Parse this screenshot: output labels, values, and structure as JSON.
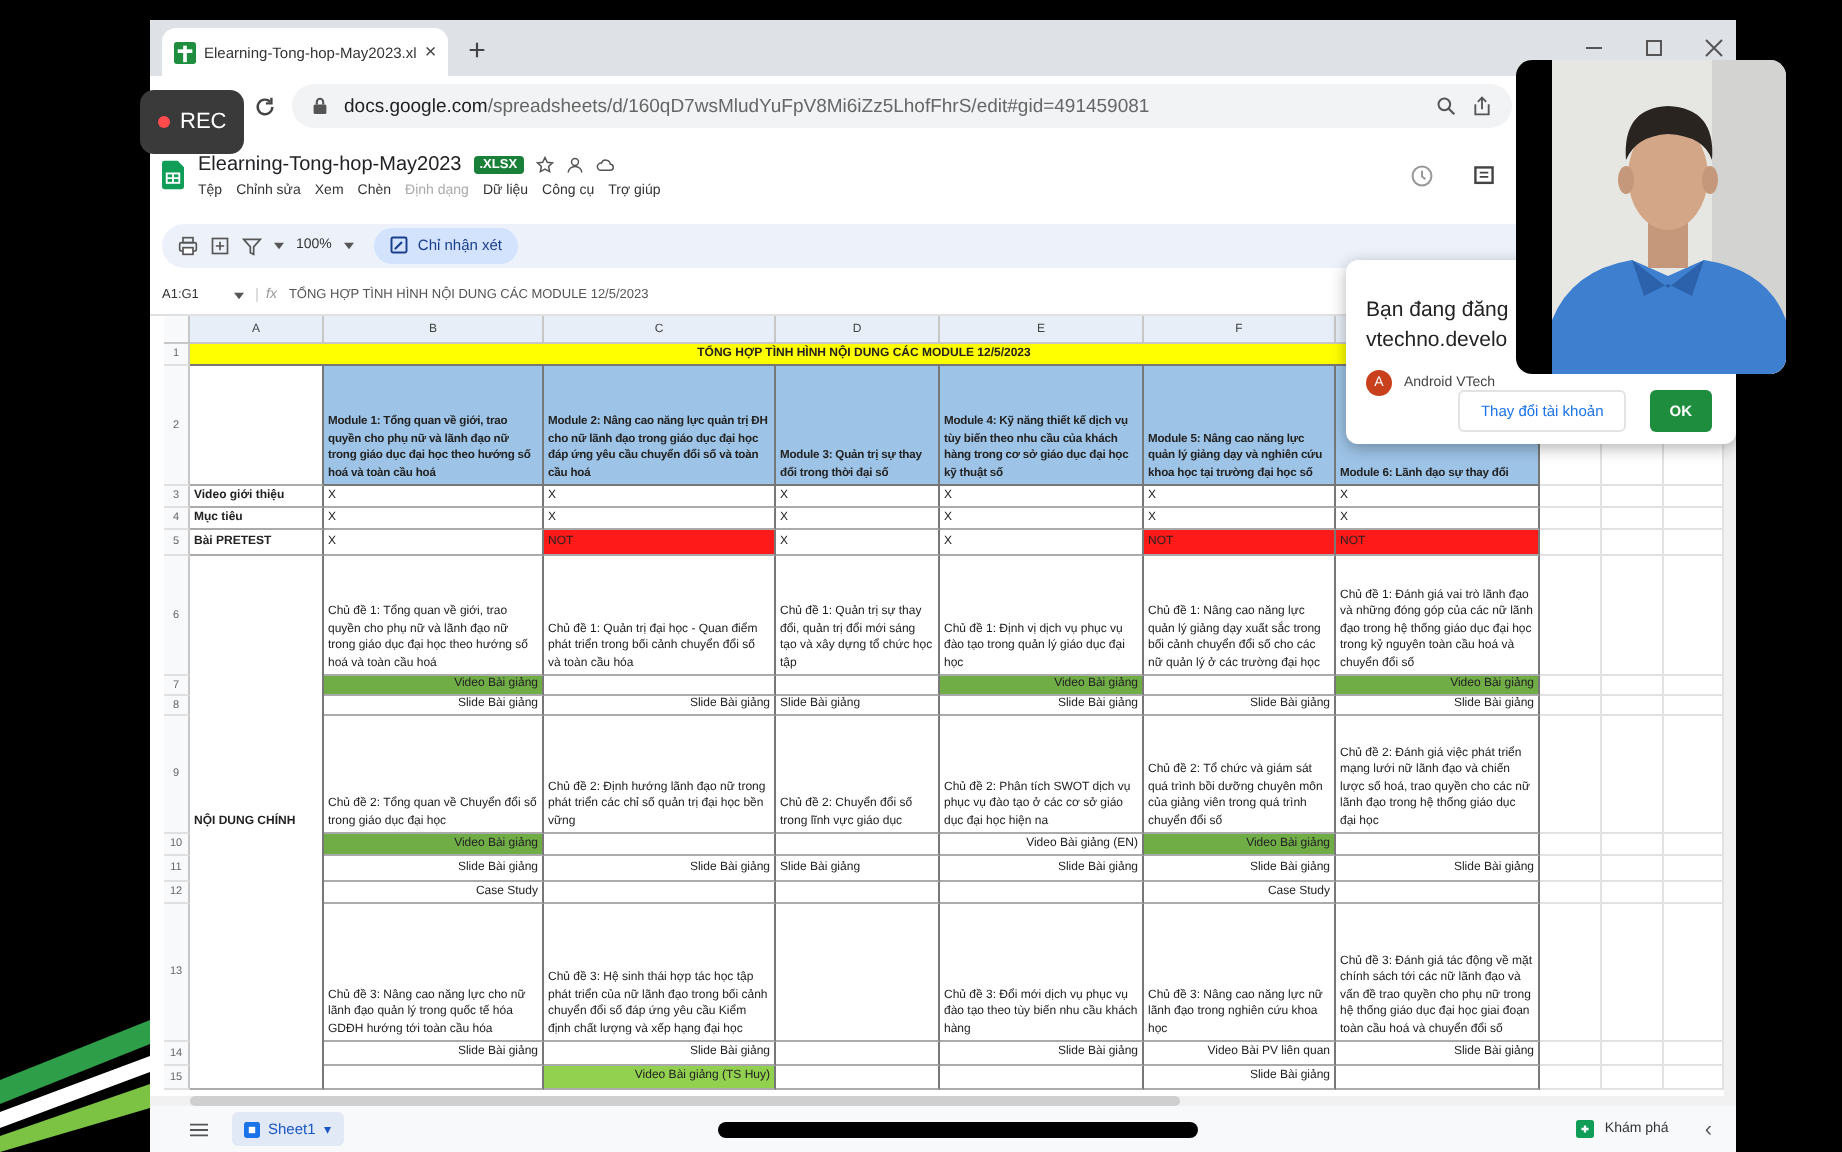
{
  "browser": {
    "tab": {
      "title": "Elearning-Tong-hop-May2023.xl",
      "close": "×",
      "selected": true
    },
    "new_tab": "+",
    "url": {
      "host": "docs.google.com",
      "path": "/spreadsheets/d/160qD7wsMludYuFpV8Mi6iZz5LhofFhrS/edit#gid=491459081"
    }
  },
  "recording": {
    "label": "REC"
  },
  "document": {
    "title": "Elearning-Tong-hop-May2023",
    "format_badge": ".XLSX",
    "menus": [
      {
        "label": "Tệp",
        "disabled": false
      },
      {
        "label": "Chỉnh sửa",
        "disabled": false
      },
      {
        "label": "Xem",
        "disabled": false
      },
      {
        "label": "Chèn",
        "disabled": false
      },
      {
        "label": "Định dạng",
        "disabled": true
      },
      {
        "label": "Dữ liệu",
        "disabled": false
      },
      {
        "label": "Công cụ",
        "disabled": false
      },
      {
        "label": "Trợ giúp",
        "disabled": false
      }
    ]
  },
  "toolbar": {
    "zoom": "100%",
    "mode_button": "Chỉ nhận xét"
  },
  "formula_bar": {
    "range": "A1:G1",
    "fx": "fx",
    "formula": "TỔNG HỢP TÌNH HÌNH NỘI DUNG CÁC MODULE 12/5/2023"
  },
  "sheet": {
    "columns": [
      "A",
      "B",
      "C",
      "D",
      "E",
      "F"
    ],
    "title": {
      "num": "1",
      "text": "TỔNG HỢP TÌNH HÌNH NỘI DUNG CÁC MODULE 12/5/2023"
    },
    "header": {
      "num": "2",
      "cells": [
        "Module 1: Tổng quan về giới, trao quyền cho phụ nữ và lãnh đạo nữ trong giáo dục đại học theo hướng số hoá và toàn cầu hoá",
        "Module 2: Nâng cao năng lực quản trị ĐH cho nữ lãnh đạo trong giáo dục đại học đáp ứng yêu cầu chuyển đổi số và toàn cầu hoá",
        "Module 3: Quản trị sự thay đổi trong thời đại số",
        "Module 4: Kỹ năng thiết kế dịch vụ tùy biến theo nhu cầu của khách hàng trong cơ sở giáo dục đại học kỹ thuật số",
        "Module 5: Nâng cao năng lực quản lý giảng dạy và nghiên cứu khoa học tại trường đại học số",
        "Module 6: Lãnh đạo sự thay đổi"
      ]
    },
    "rows": [
      {
        "num": "3",
        "label": "Video giới thiệu",
        "cells": [
          {
            "text": "X",
            "kind": "mark"
          },
          {
            "text": "X",
            "kind": "mark"
          },
          {
            "text": "X",
            "kind": "mark"
          },
          {
            "text": "X",
            "kind": "mark"
          },
          {
            "text": "X",
            "kind": "mark"
          },
          {
            "text": "X",
            "kind": "mark"
          }
        ]
      },
      {
        "num": "4",
        "label": "Mục tiêu",
        "cells": [
          {
            "text": "X",
            "kind": "mark"
          },
          {
            "text": "X",
            "kind": "mark"
          },
          {
            "text": "X",
            "kind": "mark"
          },
          {
            "text": "X",
            "kind": "mark"
          },
          {
            "text": "X",
            "kind": "mark"
          },
          {
            "text": "X",
            "kind": "mark"
          }
        ]
      },
      {
        "num": "5",
        "label": "Bài PRETEST",
        "cells": [
          {
            "text": "X",
            "kind": "mark"
          },
          {
            "text": "NOT",
            "kind": "mark",
            "color": "#ff1a1a"
          },
          {
            "text": "X",
            "kind": "mark"
          },
          {
            "text": "X",
            "kind": "mark"
          },
          {
            "text": "NOT",
            "kind": "mark",
            "color": "#ff1a1a"
          },
          {
            "text": "NOT",
            "kind": "mark",
            "color": "#ff1a1a"
          }
        ]
      },
      {
        "num": "6",
        "cells": [
          {
            "text": "Chủ đề 1: Tổng quan về giới, trao quyền cho phụ nữ và lãnh đạo nữ trong giáo dục đại học theo hướng số hoá và toàn cầu hoá",
            "kind": "topic"
          },
          {
            "text": "Chủ đề 1: Quản trị đại học - Quan điểm phát triển trong bối cảnh chuyển đổi số và toàn cầu hóa",
            "kind": "topic"
          },
          {
            "text": "Chủ đề 1: Quản trị sự thay đổi, quản trị đổi mới sáng tạo và xây dựng tổ chức học tập",
            "kind": "topic"
          },
          {
            "text": "Chủ đề 1: Định vị dịch vụ phục vụ đào tạo trong quản lý giáo dục đại học",
            "kind": "topic"
          },
          {
            "text": "Chủ đề 1: Nâng cao năng lực quản lý giảng dạy xuất sắc trong bối cảnh chuyển đổi số cho các nữ quản lý ở các trường đại học",
            "kind": "topic"
          },
          {
            "text": "Chủ đề 1: Đánh giá vai trò lãnh đạo và những đóng góp của các nữ lãnh đạo trong hệ thống giáo dục đại học trong kỷ nguyên toàn cầu hoá và chuyển đổi số",
            "kind": "topic"
          }
        ]
      },
      {
        "num": "7",
        "cells": [
          {
            "text": "Video Bài giảng",
            "kind": "resource",
            "color": "#70ad47"
          },
          null,
          null,
          {
            "text": "Video Bài giảng",
            "kind": "resource",
            "color": "#70ad47"
          },
          null,
          {
            "text": "Video Bài giảng",
            "kind": "resource",
            "color": "#70ad47"
          }
        ]
      },
      {
        "num": "8",
        "cells": [
          {
            "text": "Slide Bài giảng",
            "kind": "resource"
          },
          {
            "text": "Slide Bài giảng",
            "kind": "resource"
          },
          {
            "text": "Slide Bài giảng",
            "kind": "text"
          },
          {
            "text": "Slide Bài giảng",
            "kind": "resource"
          },
          {
            "text": "Slide Bài giảng",
            "kind": "resource"
          },
          {
            "text": "Slide Bài giảng",
            "kind": "resource"
          }
        ]
      },
      {
        "num": "9",
        "cells": [
          {
            "text": "Chủ đề 2: Tổng quan về Chuyển đổi số trong giáo dục đại học",
            "kind": "topic"
          },
          {
            "text": "Chủ đề 2: Định hướng lãnh đạo nữ trong phát triển các chỉ số quản trị đại học bền vững",
            "kind": "topic"
          },
          {
            "text": "Chủ đề 2: Chuyển đổi số trong lĩnh vực giáo dục",
            "kind": "topic"
          },
          {
            "text": "Chủ đề 2: Phân tích SWOT dịch vụ phục vụ đào tạo ở các cơ sở giáo dục đại học hiện na",
            "kind": "topic"
          },
          {
            "text": "Chủ đề 2: Tổ chức và giám sát quá trình bồi dưỡng chuyên môn của giảng viên trong quá trình chuyển đổi số",
            "kind": "topic"
          },
          {
            "text": "Chủ đề 2: Đánh giá việc phát triển mạng lưới nữ lãnh đạo và chiến lược số hoá, trao quyền cho các nữ lãnh đạo trong hệ thống giáo dục đại học",
            "kind": "topic"
          }
        ]
      },
      {
        "num": "10",
        "cells": [
          {
            "text": "Video Bài giảng",
            "kind": "resource",
            "color": "#70ad47"
          },
          null,
          null,
          {
            "text": "Video Bài giảng (EN)",
            "kind": "resource"
          },
          {
            "text": "Video Bài giảng",
            "kind": "resource",
            "color": "#70ad47"
          },
          null
        ]
      },
      {
        "num": "11",
        "cells": [
          {
            "text": "Slide Bài giảng",
            "kind": "resource"
          },
          {
            "text": "Slide Bài giảng",
            "kind": "resource"
          },
          {
            "text": "Slide Bài giảng",
            "kind": "text"
          },
          {
            "text": "Slide Bài giảng",
            "kind": "resource"
          },
          {
            "text": "Slide Bài giảng",
            "kind": "resource"
          },
          {
            "text": "Slide Bài giảng",
            "kind": "resource"
          }
        ]
      },
      {
        "num": "12",
        "cells": [
          {
            "text": "Case Study",
            "kind": "resource"
          },
          null,
          null,
          null,
          {
            "text": "Case Study",
            "kind": "resource"
          },
          null
        ]
      },
      {
        "num": "13",
        "cells": [
          {
            "text": "Chủ đề 3: Nâng cao năng lực cho nữ lãnh đạo quản lý trong quốc tế hóa GDĐH hướng tới toàn cầu hóa",
            "kind": "topic"
          },
          {
            "text": "Chủ đề 3: Hệ sinh thái hợp tác học tập phát triển của nữ lãnh đạo trong bối cảnh chuyển đổi số đáp ứng yêu cầu Kiểm định chất lượng và xếp hạng đại học",
            "kind": "topic"
          },
          null,
          {
            "text": "Chủ đề 3: Đổi mới dịch vụ phục vụ đào tạo theo tùy biến nhu cầu khách hàng",
            "kind": "topic"
          },
          {
            "text": "Chủ đề 3: Nâng cao năng lực nữ lãnh đạo trong nghiên cứu khoa học",
            "kind": "topic"
          },
          {
            "text": "Chủ đề 3: Đánh giá tác động về mặt chính sách tới các nữ lãnh đạo và vấn đề trao quyền cho phụ nữ trong hệ thống giáo dục đại học giai đoạn toàn cầu hoá và chuyển đổi số",
            "kind": "topic"
          }
        ]
      },
      {
        "num": "14",
        "cells": [
          {
            "text": "Slide Bài giảng",
            "kind": "resource"
          },
          {
            "text": "Slide Bài giảng",
            "kind": "resource"
          },
          null,
          {
            "text": "Slide Bài giảng",
            "kind": "resource"
          },
          {
            "text": "Video Bài PV liên quan",
            "kind": "resource"
          },
          {
            "text": "Slide Bài giảng",
            "kind": "resource"
          }
        ]
      },
      {
        "num": "15",
        "cells": [
          null,
          {
            "text": "Video Bài giảng (TS Huy)",
            "kind": "resource",
            "color": "#92d050"
          },
          null,
          null,
          {
            "text": "Slide Bài giảng",
            "kind": "resource"
          },
          null
        ]
      }
    ],
    "section": {
      "label": "NỘI DUNG CHÍNH"
    }
  },
  "sign_in_dialog": {
    "lines": [
      "Bạn đang đăng",
      "vtechno.develo"
    ],
    "account": {
      "initial": "A",
      "name": "Android VTech"
    },
    "buttons": [
      {
        "label": "Thay đổi tài khoản",
        "kind": "secondary"
      },
      {
        "label": "OK",
        "kind": "primary"
      }
    ]
  },
  "bottom_bar": {
    "sheet_tab": {
      "label": "Sheet1",
      "caret": "▾",
      "selected": true
    },
    "explore": "Khám phá",
    "collapse": "‹"
  }
}
